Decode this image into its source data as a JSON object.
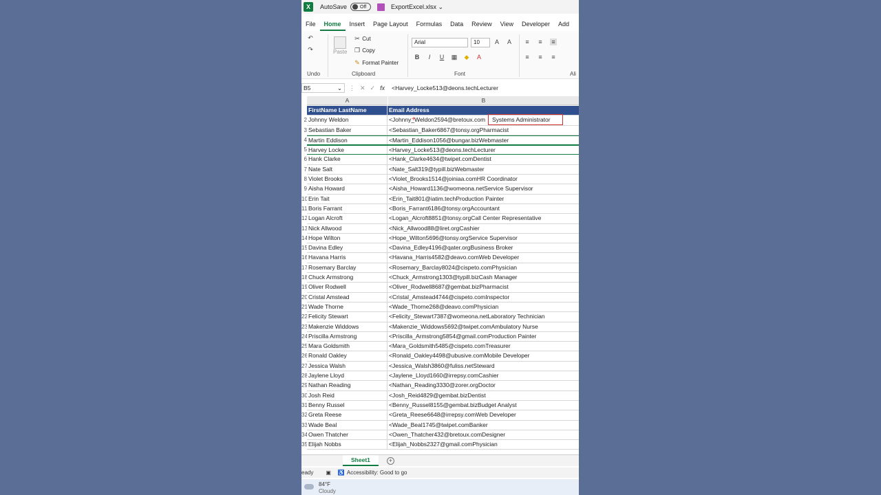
{
  "titlebar": {
    "logo": "X",
    "autosave_label": "AutoSave",
    "toggle_label": "Off",
    "filename": "ExportExcel.xlsx ⌄"
  },
  "tabs": [
    "File",
    "Home",
    "Insert",
    "Page Layout",
    "Formulas",
    "Data",
    "Review",
    "View",
    "Developer",
    "Add"
  ],
  "ribbon": {
    "undo_group": "Undo",
    "clipboard_group": "Clipboard",
    "font_group": "Font",
    "align_group": "Ali",
    "paste": "Paste",
    "cut": "Cut",
    "copy": "Copy",
    "format_painter": "Format Painter",
    "font_name": "Arial",
    "font_size": "10",
    "bold": "B",
    "italic": "I",
    "underline": "U"
  },
  "formula_bar": {
    "cell_ref": "B5",
    "content": "<Harvey_Locke513@deons.techLecturer"
  },
  "columns": [
    "A",
    "B"
  ],
  "header_row": {
    "a": "FirstName LastName",
    "b": "Email Address"
  },
  "rows": [
    {
      "n": "2",
      "a": "Johnny Weldon",
      "b": "<Johnny_Weldon2594@bretoux.com",
      "c": "Systems Administrator"
    },
    {
      "n": "3",
      "a": "Sebastian Baker",
      "b": "<Sebastian_Baker6867@tonsy.orgPharmacist"
    },
    {
      "n": "4",
      "a": "Martin Eddison",
      "b": "<Martin_Eddison1056@bungar.bizWebmaster"
    },
    {
      "n": "5",
      "a": "Harvey Locke",
      "b": "<Harvey_Locke513@deons.techLecturer"
    },
    {
      "n": "6",
      "a": "Hank Clarke",
      "b": "<Hank_Clarke4634@twipet.comDentist"
    },
    {
      "n": "7",
      "a": "Nate Salt",
      "b": "<Nate_Salt319@typill.bizWebmaster"
    },
    {
      "n": "8",
      "a": "Violet Brooks",
      "b": "<Violet_Brooks1514@joiniaa.comHR Coordinator"
    },
    {
      "n": "9",
      "a": "Aisha Howard",
      "b": "<Aisha_Howard1136@womeona.netService Supervisor"
    },
    {
      "n": "10",
      "a": "Erin Tait",
      "b": "<Erin_Tait801@iatim.techProduction Painter"
    },
    {
      "n": "11",
      "a": "Boris Farrant",
      "b": "<Boris_Farrant6186@tonsy.orgAccountant"
    },
    {
      "n": "12",
      "a": "Logan Alcroft",
      "b": "<Logan_Alcroft8851@tonsy.orgCall Center Representative"
    },
    {
      "n": "13",
      "a": "Nick Allwood",
      "b": "<Nick_Allwood88@liret.orgCashier"
    },
    {
      "n": "14",
      "a": "Hope Wilton",
      "b": "<Hope_Wilton5696@tonsy.orgService Supervisor"
    },
    {
      "n": "15",
      "a": "Davina Edley",
      "b": "<Davina_Edley4196@qater.orgBusiness Broker"
    },
    {
      "n": "16",
      "a": "Havana Harris",
      "b": "<Havana_Harris4582@deavo.comWeb Developer"
    },
    {
      "n": "17",
      "a": "Rosemary Barclay",
      "b": "<Rosemary_Barclay8024@cispeto.comPhysician"
    },
    {
      "n": "18",
      "a": "Chuck Armstrong",
      "b": "<Chuck_Armstrong1303@typill.bizCash Manager"
    },
    {
      "n": "19",
      "a": "Oliver Rodwell",
      "b": "<Oliver_Rodwell8687@gembat.bizPharmacist"
    },
    {
      "n": "20",
      "a": "Cristal Amstead",
      "b": "<Cristal_Amstead4744@cispeto.comInspector"
    },
    {
      "n": "21",
      "a": "Wade Thorne",
      "b": "<Wade_Thorne268@deavo.comPhysician"
    },
    {
      "n": "22",
      "a": "Felicity Stewart",
      "b": "<Felicity_Stewart7387@womeona.netLaboratory Technician"
    },
    {
      "n": "23",
      "a": "Makenzie Widdows",
      "b": "<Makenzie_Widdows5692@twipet.comAmbulatory Nurse"
    },
    {
      "n": "24",
      "a": "Priscilla Armstrong",
      "b": "<Priscilla_Armstrong5854@gmail.comProduction Painter"
    },
    {
      "n": "25",
      "a": "Mara Goldsmith",
      "b": "<Mara_Goldsmith5485@cispeto.comTreasurer"
    },
    {
      "n": "26",
      "a": "Ronald Oakley",
      "b": "<Ronald_Oakley4498@ubusive.comMobile Developer"
    },
    {
      "n": "27",
      "a": "Jessica Walsh",
      "b": "<Jessica_Walsh3860@fuliss.netSteward"
    },
    {
      "n": "28",
      "a": "Jaylene Lloyd",
      "b": "<Jaylene_Lloyd1660@irrepsy.comCashier"
    },
    {
      "n": "29",
      "a": "Nathan Reading",
      "b": "<Nathan_Reading3330@zorer.orgDoctor"
    },
    {
      "n": "30",
      "a": "Josh Reid",
      "b": "<Josh_Reid4829@gembat.bizDentist"
    },
    {
      "n": "31",
      "a": "Benny Russel",
      "b": "<Benny_Russel8155@gembat.bizBudget Analyst"
    },
    {
      "n": "32",
      "a": "Greta Reese",
      "b": "<Greta_Reese6648@irrepsy.comWeb Developer"
    },
    {
      "n": "33",
      "a": "Wade Beal",
      "b": "<Wade_Beal1745@twipet.comBanker"
    },
    {
      "n": "34",
      "a": "Owen Thatcher",
      "b": "<Owen_Thatcher432@bretoux.comDesigner"
    },
    {
      "n": "35",
      "a": "Elijah Nobbs",
      "b": "<Elijah_Nobbs2327@gmail.comPhysician"
    }
  ],
  "sheet": {
    "tab": "Sheet1",
    "add": "+"
  },
  "status": {
    "ready": "eady",
    "accessibility": "Accessibility: Good to go"
  },
  "weather": {
    "temp": "84°F",
    "condition": "Cloudy"
  },
  "colors": {
    "accent": "#107c41",
    "header_fill": "#2f4f8f",
    "highlight": "#d32f2f"
  }
}
